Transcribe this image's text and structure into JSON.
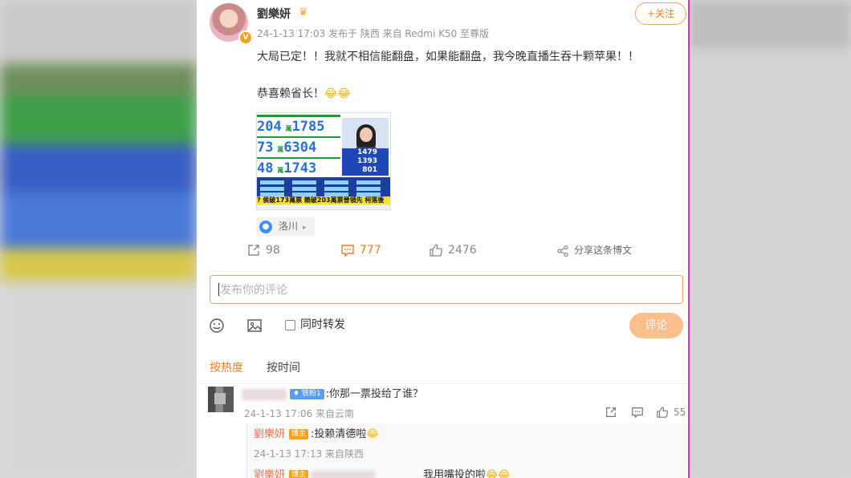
{
  "post": {
    "username": "劉樂妍",
    "meta": "24-1-13 17:03  发布于 陕西  来自 Redmi K50 至尊版",
    "follow_label": "+关注",
    "text_line1": "大局已定！！我就不相信能翻盘，如果能翻盘，我今晚直播生吞十颗苹果！！",
    "text_line2": "恭喜赖省长！",
    "emoji": "😂😂",
    "image": {
      "numbers": [
        "204",
        "1785",
        "73",
        "6304",
        "48",
        "1743"
      ],
      "vote_right": [
        "1479",
        "1393",
        "801"
      ],
      "ticker": "? 侯破173萬票 賴破203萬票晉領先 柯落後"
    },
    "location": "洛川"
  },
  "actions": {
    "repost_count": "98",
    "comment_count": "777",
    "like_count": "2476",
    "share_label": "分享这条博文"
  },
  "comment_input": {
    "placeholder": "发布你的评论",
    "repost_label": "同时转发",
    "submit_label": "评论"
  },
  "sort_tabs": {
    "hot": "按热度",
    "time": "按时间"
  },
  "comments": [
    {
      "fan_badge": "铁粉1",
      "text": ":你那一票投给了谁？",
      "meta": "24-1-13 17:06 来自云南",
      "likes": "55",
      "replies": [
        {
          "name": "劉樂妍",
          "badge": "博主",
          "text": ":投赖清德啦",
          "emoji": "😂",
          "meta": "24-1-13 17:13 来自陕西"
        },
        {
          "name": "劉樂妍",
          "badge": "博主",
          "text": "我用嘴投的啦",
          "emoji": "😂😂"
        }
      ]
    }
  ]
}
